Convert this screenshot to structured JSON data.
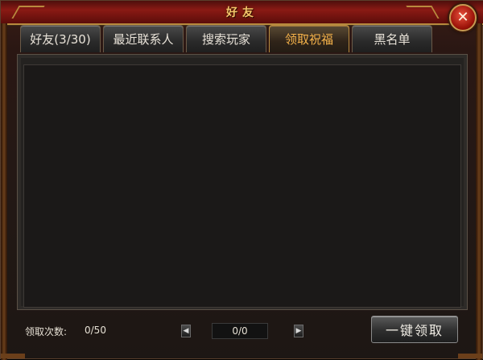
{
  "window": {
    "title": "好友",
    "close_symbol": "✕"
  },
  "tabs": [
    {
      "label": "好友(3/30)",
      "active": false
    },
    {
      "label": "最近联系人",
      "active": false
    },
    {
      "label": "搜索玩家",
      "active": false
    },
    {
      "label": "领取祝福",
      "active": true
    },
    {
      "label": "黑名单",
      "active": false
    }
  ],
  "footer": {
    "claim_count_label": "领取次数:",
    "claim_count_value": "0/50",
    "page_indicator": "0/0",
    "prev_symbol": "◀",
    "next_symbol": "▶",
    "claim_all_label": "一键领取"
  },
  "colors": {
    "active_tab_text": "#f5b24a",
    "title_text": "#f2c56a"
  }
}
